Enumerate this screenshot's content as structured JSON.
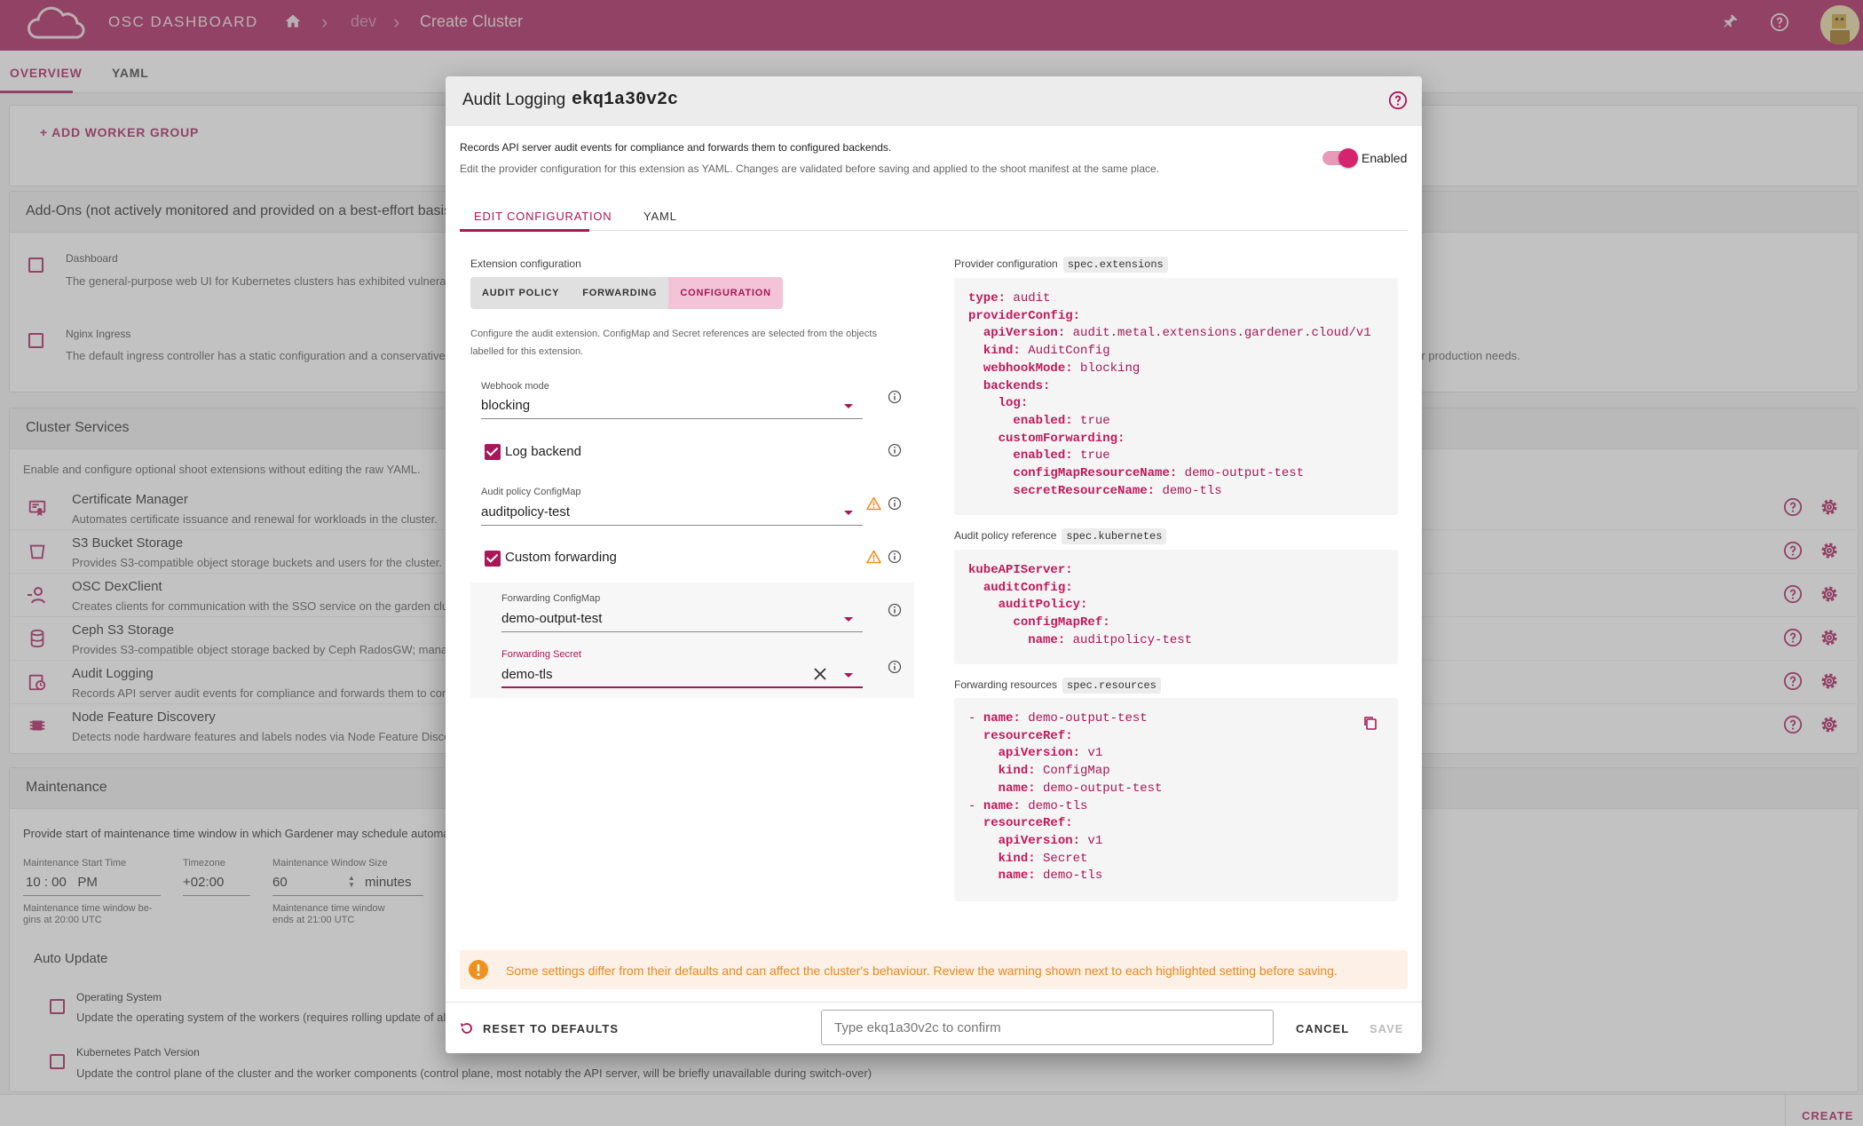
{
  "app": {
    "brand": "OSC DASHBOARD",
    "breadcrumb": [
      "dev",
      "Create Cluster"
    ]
  },
  "page_tabs": [
    "OVERVIEW",
    "YAML"
  ],
  "workers": {
    "add_label": "+ ADD WORKER GROUP"
  },
  "addons": {
    "title": "Add-Ons (not actively monitored and provided on a best-effort basis only)",
    "items": [
      {
        "name": "Dashboard",
        "desc": "The general-purpose web UI for Kubernetes clusters has exhibited vulnerab"
      },
      {
        "name": "Nginx Ingress",
        "desc": "The default ingress controller has a static configuration and a conservative",
        "desc_tail": "to your production needs."
      }
    ]
  },
  "services": {
    "title": "Cluster Services",
    "intro": "Enable and configure optional shoot extensions without editing the raw YAML.",
    "items": [
      {
        "name": "Certificate Manager",
        "desc": "Automates certificate issuance and renewal for workloads in the cluster.",
        "icon": "certificate-icon"
      },
      {
        "name": "S3 Bucket Storage",
        "desc": "Provides S3-compatible object storage buckets and users for the cluster.",
        "icon": "bucket-icon"
      },
      {
        "name": "OSC DexClient",
        "desc": "Creates clients for communication with the SSO service on the garden clu",
        "icon": "user-connect-icon"
      },
      {
        "name": "Ceph S3 Storage",
        "desc": "Provides S3-compatible object storage backed by Ceph RadosGW; manag",
        "icon": "database-icon"
      },
      {
        "name": "Audit Logging",
        "desc": "Records API server audit events for compliance and forwards them to con",
        "icon": "audit-clock-icon"
      },
      {
        "name": "Node Feature Discovery",
        "desc": "Detects node hardware features and labels nodes via Node Feature Discov",
        "icon": "chip-icon"
      }
    ]
  },
  "maintenance": {
    "title": "Maintenance",
    "intro": "Provide start of maintenance time window in which Gardener may schedule automat",
    "start_label": "Maintenance Start Time",
    "start_value": "10 : 00   PM",
    "start_hint": [
      "Maintenance time window be-",
      "gins at 20:00 UTC"
    ],
    "tz_label": "Timezone",
    "tz_value": "+02:00",
    "size_label": "Maintenance Window Size",
    "size_value": "60",
    "size_unit": "minutes",
    "size_hint": [
      "Maintenance time window",
      "ends at 21:00 UTC"
    ],
    "auto_update_title": "Auto Update",
    "os_title": "Operating System",
    "os_desc": "Update the operating system of the workers (requires rolling update of al",
    "k8s_title": "Kubernetes Patch Version",
    "k8s_desc": "Update the control plane of the cluster and the worker components (control plane, most notably the API server, will be briefly unavailable during switch-over)"
  },
  "footer": {
    "create_label": "CREATE"
  },
  "dialog": {
    "title": "Audit Logging",
    "name": "ekq1a30v2c",
    "description": "Records API server audit events for compliance and forwards them to configured backends.",
    "subdescription": "Edit the provider configuration for this extension as YAML. Changes are validated before saving and applied to the shoot manifest at the same place.",
    "enabled_label": "Enabled",
    "enabled": true,
    "tabs": [
      "EDIT CONFIGURATION",
      "YAML"
    ],
    "ext_config_label": "Extension configuration",
    "segments": [
      "AUDIT POLICY",
      "FORWARDING",
      "CONFIGURATION"
    ],
    "config_help": [
      "Configure the audit extension. ConfigMap and Secret references are selected from the objects",
      "labelled for this extension."
    ],
    "webhook_label": "Webhook mode",
    "webhook_value": "blocking",
    "log_backend_label": "Log backend",
    "log_backend_checked": true,
    "policy_cm_label": "Audit policy ConfigMap",
    "policy_cm_value": "auditpolicy-test",
    "custom_fwd_label": "Custom forwarding",
    "custom_fwd_checked": true,
    "fwd_cm_label": "Forwarding ConfigMap",
    "fwd_cm_value": "demo-output-test",
    "fwd_secret_label": "Forwarding Secret",
    "fwd_secret_value": "demo-tls",
    "provider_label": "Provider configuration",
    "provider_path": "spec.extensions",
    "policy_ref_label": "Audit policy reference",
    "policy_ref_path": "spec.kubernetes",
    "fwd_res_label": "Forwarding resources",
    "fwd_res_path": "spec.resources",
    "provider_yaml": [
      {
        "k": "type:",
        "v": " audit",
        "i": 0
      },
      {
        "k": "providerConfig:",
        "v": "",
        "i": 0
      },
      {
        "k": "apiVersion:",
        "v": " audit.metal.extensions.gardener.cloud/v1",
        "i": 1
      },
      {
        "k": "kind:",
        "v": " AuditConfig",
        "i": 1
      },
      {
        "k": "webhookMode:",
        "v": " blocking",
        "i": 1
      },
      {
        "k": "backends:",
        "v": "",
        "i": 1
      },
      {
        "k": "log:",
        "v": "",
        "i": 2
      },
      {
        "k": "enabled:",
        "v": " true",
        "i": 3
      },
      {
        "k": "customForwarding:",
        "v": "",
        "i": 2
      },
      {
        "k": "enabled:",
        "v": " true",
        "i": 3
      },
      {
        "k": "configMapResourceName:",
        "v": " demo-output-test",
        "i": 3
      },
      {
        "k": "secretResourceName:",
        "v": " demo-tls",
        "i": 3
      }
    ],
    "policy_yaml": [
      {
        "k": "kubeAPIServer:",
        "v": "",
        "i": 0
      },
      {
        "k": "auditConfig:",
        "v": "",
        "i": 1
      },
      {
        "k": "auditPolicy:",
        "v": "",
        "i": 2
      },
      {
        "k": "configMapRef:",
        "v": "",
        "i": 3
      },
      {
        "k": "name:",
        "v": " auditpolicy-test",
        "i": 4
      }
    ],
    "resources_yaml": [
      {
        "d": "- ",
        "k": "name:",
        "v": " demo-output-test",
        "i": 0
      },
      {
        "k": "resourceRef:",
        "v": "",
        "i": 1
      },
      {
        "k": "apiVersion:",
        "v": " v1",
        "i": 2
      },
      {
        "k": "kind:",
        "v": " ConfigMap",
        "i": 2
      },
      {
        "k": "name:",
        "v": " demo-output-test",
        "i": 2
      },
      {
        "d": "- ",
        "k": "name:",
        "v": " demo-tls",
        "i": 0
      },
      {
        "k": "resourceRef:",
        "v": "",
        "i": 1
      },
      {
        "k": "apiVersion:",
        "v": " v1",
        "i": 2
      },
      {
        "k": "kind:",
        "v": " Secret",
        "i": 2
      },
      {
        "k": "name:",
        "v": " demo-tls",
        "i": 2
      }
    ],
    "warning": "Some settings differ from their defaults and can affect the cluster's behaviour. Review the warning shown next to each highlighted setting before saving.",
    "reset_label": "RESET TO DEFAULTS",
    "confirm_placeholder": "Type ekq1a30v2c to confirm",
    "cancel_label": "CANCEL",
    "save_label": "SAVE"
  },
  "colors": {
    "brand": "#a81757",
    "accent": "#d4246e",
    "warning": "#f0901e",
    "warning_bg": "#fdf0e6"
  }
}
